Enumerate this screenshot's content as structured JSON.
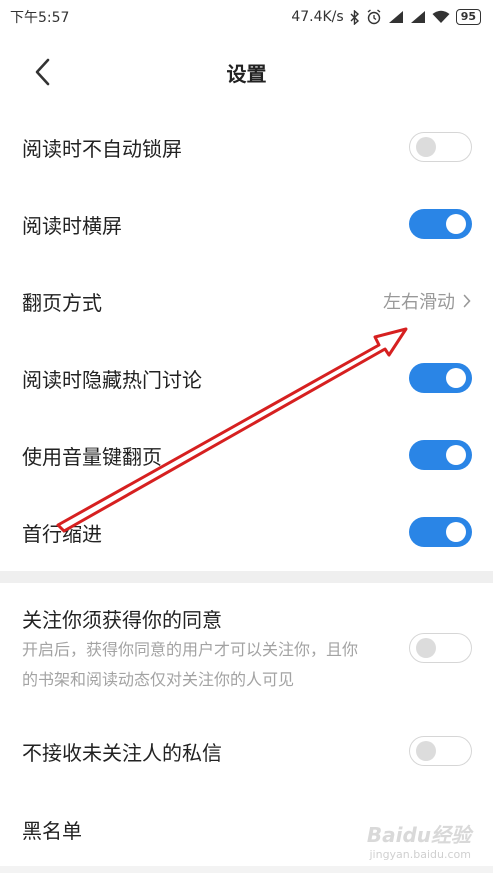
{
  "status_bar": {
    "time": "下午5:57",
    "network_speed": "47.4K/s",
    "battery": "95",
    "icons": [
      "bluetooth-icon",
      "alarm-icon",
      "signal-icon",
      "signal-icon",
      "wifi-icon",
      "battery-icon"
    ]
  },
  "header": {
    "title": "设置",
    "back_icon": "chevron-left-icon"
  },
  "settings": [
    {
      "label": "阅读时不自动锁屏",
      "type": "toggle",
      "on": false
    },
    {
      "label": "阅读时横屏",
      "type": "toggle",
      "on": true
    },
    {
      "label": "翻页方式",
      "type": "link",
      "value": "左右滑动"
    },
    {
      "label": "阅读时隐藏热门讨论",
      "type": "toggle",
      "on": true
    },
    {
      "label": "使用音量键翻页",
      "type": "toggle",
      "on": true
    },
    {
      "label": "首行缩进",
      "type": "toggle",
      "on": true
    }
  ],
  "privacy": [
    {
      "label": "关注你须获得你的同意",
      "description_line1": "开启后，获得你同意的用户才可以关注你，且你",
      "description_line2": "的书架和阅读动态仅对关注你的人可见",
      "type": "toggle",
      "on": false
    },
    {
      "label": "不接收未关注人的私信",
      "type": "toggle",
      "on": false
    },
    {
      "label": "黑名单",
      "type": "link"
    }
  ],
  "annotation": {
    "arrow_color": "#d62020"
  },
  "watermark": {
    "logo": "Baidu经验",
    "url": "jingyan.baidu.com"
  },
  "colors": {
    "accent": "#2a85e6",
    "divider": "#efefef",
    "secondary_text": "#999999"
  }
}
